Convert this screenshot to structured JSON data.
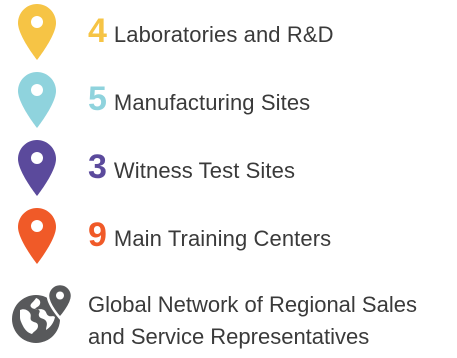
{
  "items": [
    {
      "number": "4",
      "label": "Laboratories and R&D",
      "color": "#F6C445",
      "icon": "map-pin-icon"
    },
    {
      "number": "5",
      "label": "Manufacturing Sites",
      "color": "#8FD3DD",
      "icon": "map-pin-icon"
    },
    {
      "number": "3",
      "label": "Witness Test Sites",
      "color": "#5B4A9C",
      "icon": "map-pin-icon"
    },
    {
      "number": "9",
      "label": "Main Training Centers",
      "color": "#F05A28",
      "icon": "map-pin-icon"
    }
  ],
  "global": {
    "line1": "Global Network of Regional Sales",
    "line2": "and Service Representatives",
    "icon": "globe-pin-icon",
    "color": "#58595B"
  }
}
